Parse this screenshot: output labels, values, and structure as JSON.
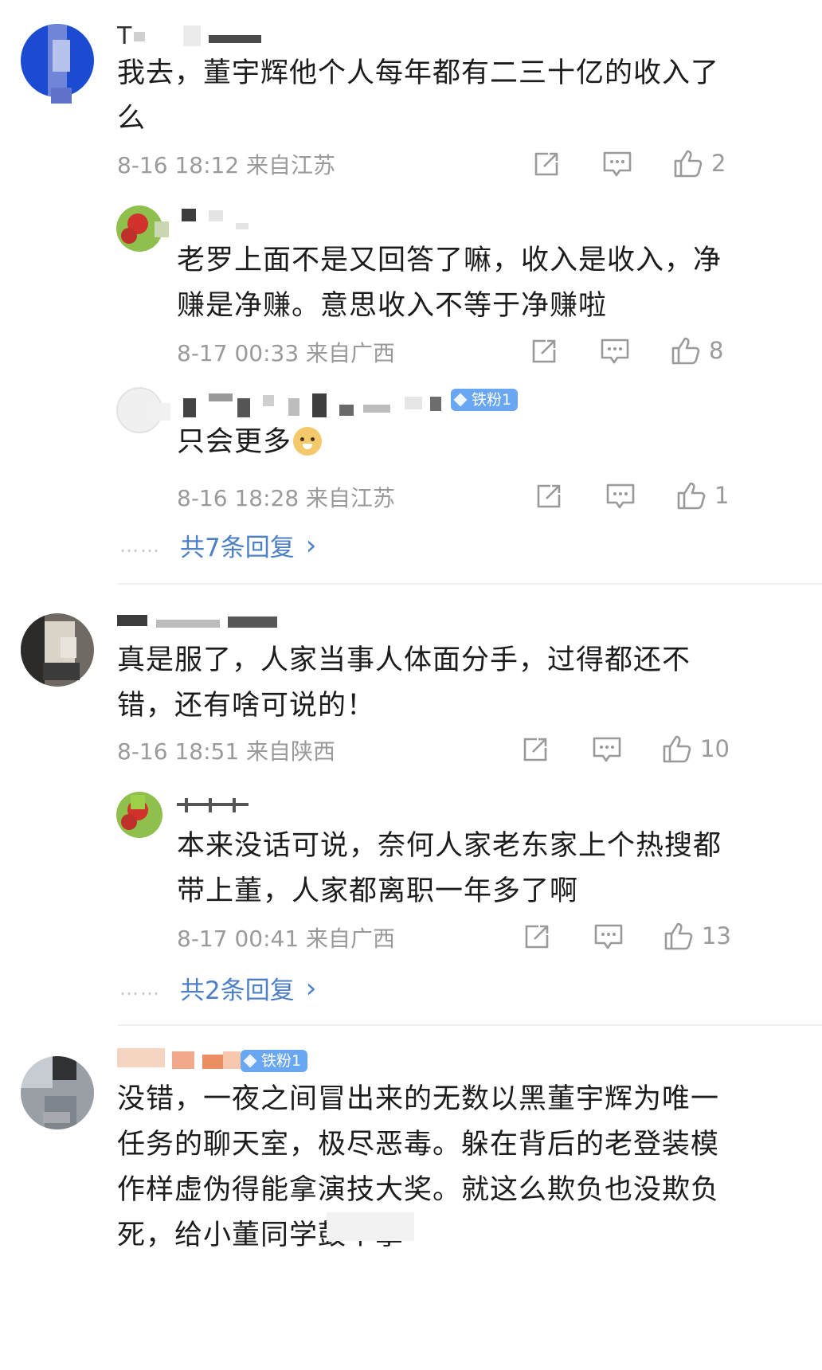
{
  "comments": [
    {
      "name": "T",
      "text": "我去，董宇辉他个人每年都有二三十亿的收入了么",
      "meta": "8-16 18:12 来自江苏",
      "likes": "2",
      "replies": [
        {
          "text": "老罗上面不是又回答了嘛，收入是收入，净赚是净赚。意思收入不等于净赚啦",
          "meta": "8-17 00:33 来自广西",
          "likes": "8"
        },
        {
          "badge": "铁粉1",
          "text": "只会更多",
          "emoji": "doge-emoji",
          "meta": "8-16 18:28 来自江苏",
          "likes": "1"
        }
      ],
      "more": "共7条回复"
    },
    {
      "text": "真是服了，人家当事人体面分手，过得都还不错，还有啥可说的！",
      "meta": "8-16 18:51 来自陕西",
      "likes": "10",
      "replies": [
        {
          "text": "本来没话可说，奈何人家老东家上个热搜都带上董，人家都离职一年多了啊",
          "meta": "8-17 00:41 来自广西",
          "likes": "13"
        }
      ],
      "more": "共2条回复"
    },
    {
      "badge": "铁粉1",
      "text": "没错，一夜之间冒出来的无数以黑董宇辉为唯一任务的聊天室，极尽恶毒。躲在背后的老登装模作样虚伪得能拿演技大奖。就这么欺负也没欺负死，给小董同学鼓个掌"
    }
  ],
  "more_arrow": "›",
  "dots": "……",
  "icons": {
    "share": "share-icon",
    "comment": "comment-icon",
    "like": "like-icon"
  },
  "colors": {
    "link": "#4d7fc6",
    "meta": "#9a9a9a",
    "badge": "#6aa7f2",
    "divider": "#efefef"
  }
}
